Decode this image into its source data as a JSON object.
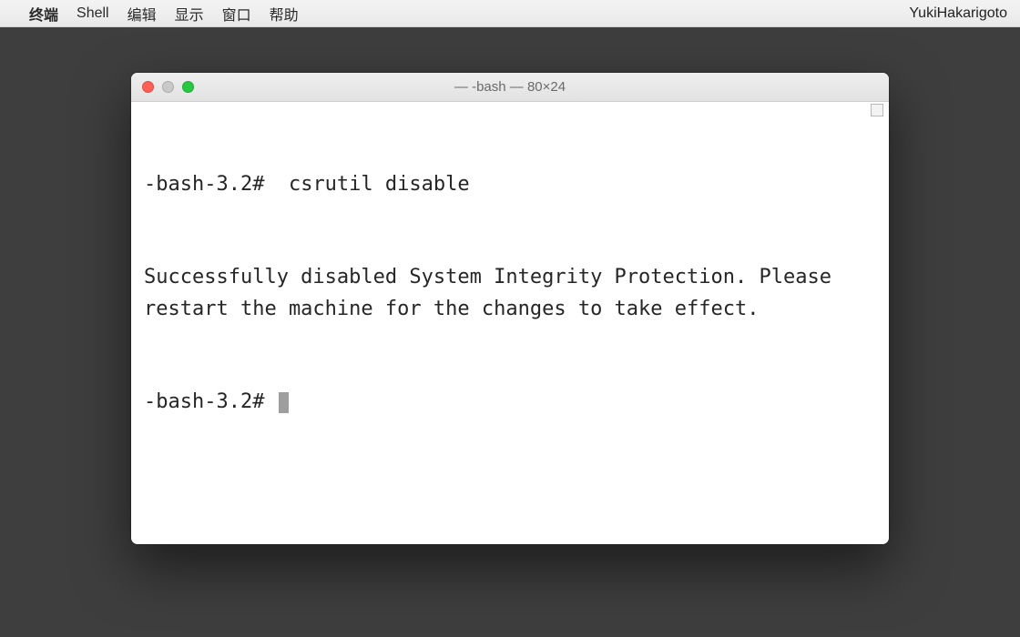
{
  "menubar": {
    "apple_glyph": "",
    "app_name": "终端",
    "items": [
      "Shell",
      "编辑",
      "显示",
      "窗口",
      "帮助"
    ],
    "right_status": "YukiHakarigoto"
  },
  "window": {
    "title": "— -bash — 80×24",
    "traffic": {
      "close": "close",
      "minimize": "minimize",
      "zoom": "zoom"
    }
  },
  "terminal": {
    "lines": [
      {
        "prompt": "-bash-3.2# ",
        "command": " csrutil disable"
      },
      {
        "text": "Successfully disabled System Integrity Protection. Please restart the machine for the changes to take effect."
      },
      {
        "prompt": "-bash-3.2# ",
        "cursor": true
      }
    ]
  }
}
